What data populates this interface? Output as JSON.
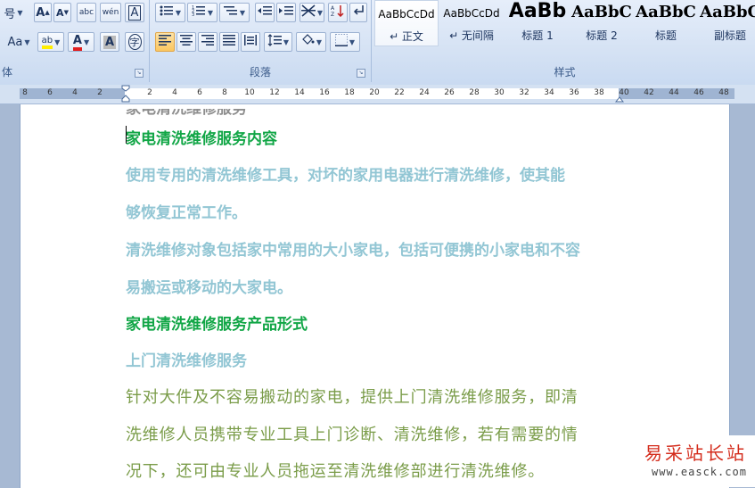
{
  "ribbon": {
    "font_group": {
      "label": "体",
      "row1": [
        "号",
        "A",
        "A",
        "abc",
        "wén",
        "A"
      ],
      "row2": [
        "Aa",
        "ab",
        "A",
        "A",
        "字"
      ]
    },
    "paragraph_group": {
      "label": "段落"
    },
    "styles_group": {
      "label": "样式",
      "items": [
        {
          "sample": "AaBbCcDd",
          "name": "↵ 正文"
        },
        {
          "sample": "AaBbCcDd",
          "name": "↵ 无间隔"
        },
        {
          "sample": "AaBb",
          "name": "标题 1"
        },
        {
          "sample": "AaBbC",
          "name": "标题 2"
        },
        {
          "sample": "AaBbC",
          "name": "标题"
        },
        {
          "sample": "AaBbC",
          "name": "副标题"
        }
      ]
    }
  },
  "ruler": {
    "left_ticks": [
      "8",
      "6",
      "4",
      "2"
    ],
    "right_ticks": [
      "2",
      "4",
      "6",
      "8",
      "10",
      "12",
      "14",
      "16",
      "18",
      "20",
      "22",
      "24",
      "26",
      "28",
      "30",
      "32",
      "34",
      "36",
      "38",
      "40",
      "42",
      "44",
      "46",
      "48"
    ]
  },
  "document": {
    "cut_line": "家电清洗维修服务",
    "paragraphs": [
      {
        "text": "家电清洗维修服务内容",
        "style": "green"
      },
      {
        "text": " 使用专用的清洗维修工具，对坏的家用电器进行清洗维修，使其能",
        "style": "teal"
      },
      {
        "text": "够恢复正常工作。",
        "style": "teal"
      },
      {
        "text": "清洗维修对象包括家中常用的大小家电，包括可便携的小家电和不容",
        "style": "teal"
      },
      {
        "text": "易搬运或移动的大家电。",
        "style": "teal"
      },
      {
        "text": " 家电清洗维修服务产品形式",
        "style": "green"
      },
      {
        "text": "上门清洗维修服务",
        "style": "teal"
      },
      {
        "text": " 针对大件及不容易搬动的家电，提供上门清洗维修服务，即清",
        "style": "olive"
      },
      {
        "text": "洗维修人员携带专业工具上门诊断、清洗维修，若有需要的情",
        "style": "olive"
      },
      {
        "text": "况下，还可由专业人员拖运至清洗维修部进行清洗维修。",
        "style": "olive"
      }
    ]
  },
  "watermark": {
    "title": "易采站长站",
    "url": "www.easck.com"
  },
  "colors": {
    "heading_green": "#11a646",
    "body_teal": "#92c6d4",
    "body_olive": "#7a9c49"
  }
}
